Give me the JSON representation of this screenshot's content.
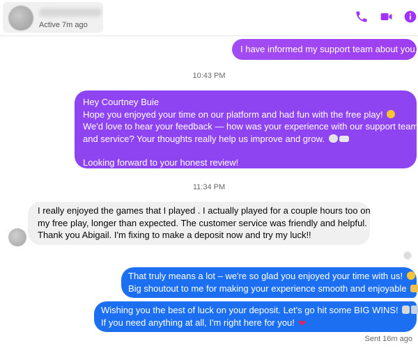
{
  "header": {
    "status": "Active 7m ago"
  },
  "colors": {
    "accent_purple": "#9d3ef0",
    "outgoing_blue": "#1b6ff0",
    "incoming_gray": "#f0f0f0",
    "icon_purple": "#a033ff"
  },
  "icons": [
    "phone-icon",
    "video-icon",
    "info-icon"
  ],
  "messages": [
    {
      "direction": "outgoing",
      "lines": [
        "I have informed my support team about you."
      ]
    },
    {
      "direction": "outgoing",
      "lines": [
        "Hey Courtney Buie",
        "Hope you enjoyed your time on our platform and had fun with the free play!",
        "We'd love to hear your feedback — how was your experience with our support team",
        "and service? Your thoughts really help us improve and grow.",
        "Looking forward to your honest review!"
      ]
    },
    {
      "direction": "incoming",
      "lines": [
        "I really enjoyed the games that I played . I actually played for a couple hours too on",
        "my free play, longer than expected. The customer service was friendly and helpful.",
        "Thank you Abigail. I'm fixing to make a deposit now and try my luck!!"
      ]
    },
    {
      "direction": "outgoing",
      "lines": [
        "That truly means a lot – we're so glad you enjoyed your time with us!",
        "Big shoutout to me for making your experience smooth and enjoyable"
      ]
    },
    {
      "direction": "outgoing",
      "lines": [
        "Wishing you the best of luck on your deposit. Let's go hit some BIG WINS!",
        "If you need anything at all, I'm right here for you!"
      ]
    }
  ],
  "timestamps": [
    "10:43 PM",
    "11:34 PM"
  ],
  "sent_status": "Sent 16m ago"
}
